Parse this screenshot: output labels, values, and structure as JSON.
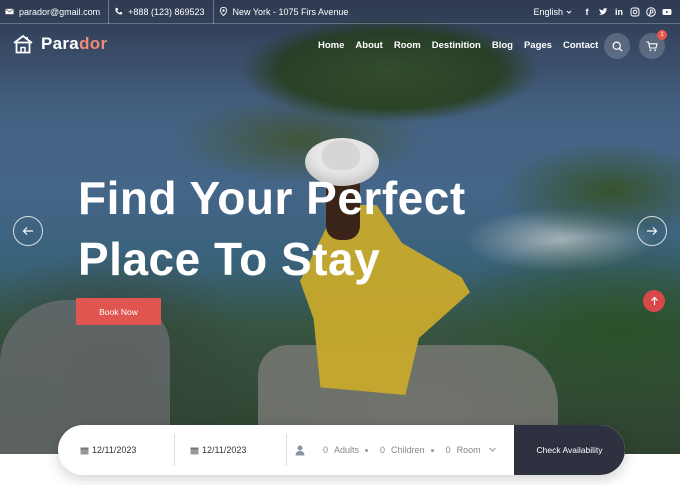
{
  "topbar": {
    "email": "parador@gmail.com",
    "phone": "+888 (123) 869523",
    "address": "New York - 1075 Firs Avenue",
    "language": "English",
    "socials": [
      "facebook-icon",
      "twitter-icon",
      "linkedin-icon",
      "instagram-icon",
      "pinterest-icon",
      "youtube-icon"
    ]
  },
  "nav": {
    "logo_main": "Para",
    "logo_accent": "dor",
    "menu": [
      "Home",
      "About",
      "Room",
      "Destinition",
      "Blog",
      "Pages",
      "Contact"
    ],
    "cart_count": "1"
  },
  "hero": {
    "headline": "Find Your Perfect\nPlace To Stay",
    "cta_label": "Book Now"
  },
  "booking": {
    "check_in": "12/11/2023",
    "check_out": "12/11/2023",
    "adults_count": "0",
    "adults_label": "Adults",
    "children_count": "0",
    "children_label": "Children",
    "room_count": "0",
    "room_label": "Room",
    "submit_label": "Check Availability"
  },
  "colors": {
    "accent": "#e0554f",
    "dark": "#2d3140",
    "logo_accent": "#f08a7a"
  }
}
